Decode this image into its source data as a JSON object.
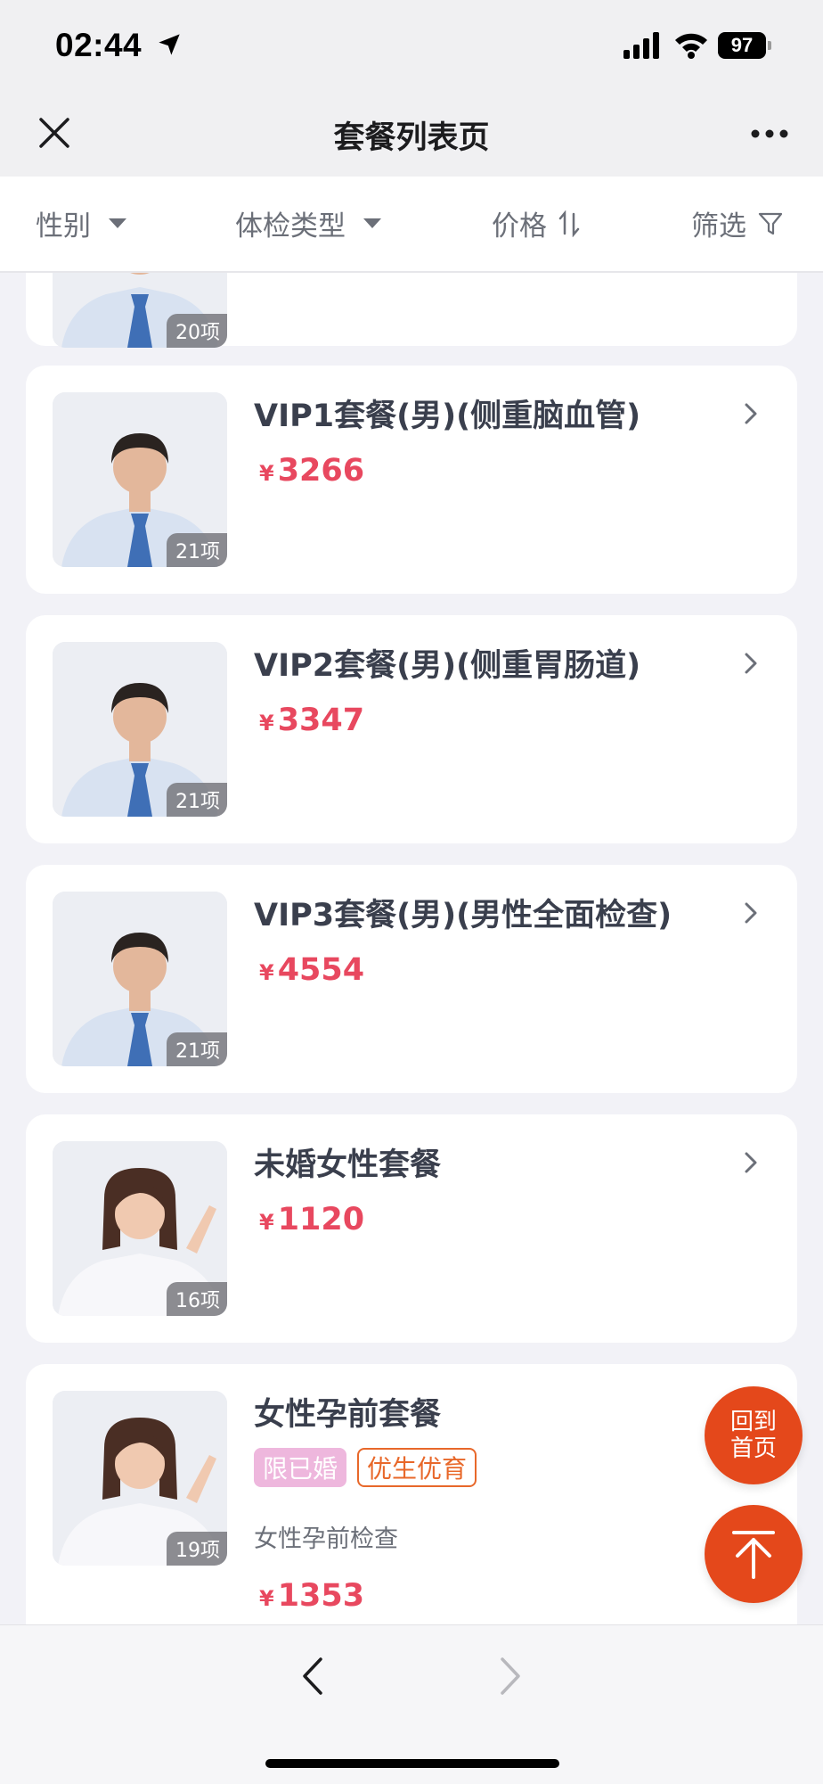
{
  "status_bar": {
    "time": "02:44",
    "battery": "97"
  },
  "nav": {
    "title": "套餐列表页"
  },
  "filters": {
    "gender": "性别",
    "exam_type": "体检类型",
    "price": "价格",
    "filter": "筛选"
  },
  "packages": [
    {
      "count": "20项"
    },
    {
      "title": "VIP1套餐(男)(侧重脑血管)",
      "currency": "¥",
      "price": "3266",
      "count": "21项"
    },
    {
      "title": "VIP2套餐(男)(侧重胃肠道)",
      "currency": "¥",
      "price": "3347",
      "count": "21项"
    },
    {
      "title": "VIP3套餐(男)(男性全面检查)",
      "currency": "¥",
      "price": "4554",
      "count": "21项"
    },
    {
      "title": "未婚女性套餐",
      "currency": "¥",
      "price": "1120",
      "count": "16项"
    },
    {
      "title": "女性孕前套餐",
      "tags": [
        "限已婚",
        "优生优育"
      ],
      "description": "女性孕前检查",
      "currency": "¥",
      "price": "1353",
      "count": "19项"
    }
  ],
  "fab": {
    "home_line1": "回到",
    "home_line2": "首页"
  },
  "colors": {
    "price": "#e8485f",
    "accent": "#e4481b",
    "tag_pink": "#eeb7dd",
    "tag_orange": "#e8682a"
  }
}
